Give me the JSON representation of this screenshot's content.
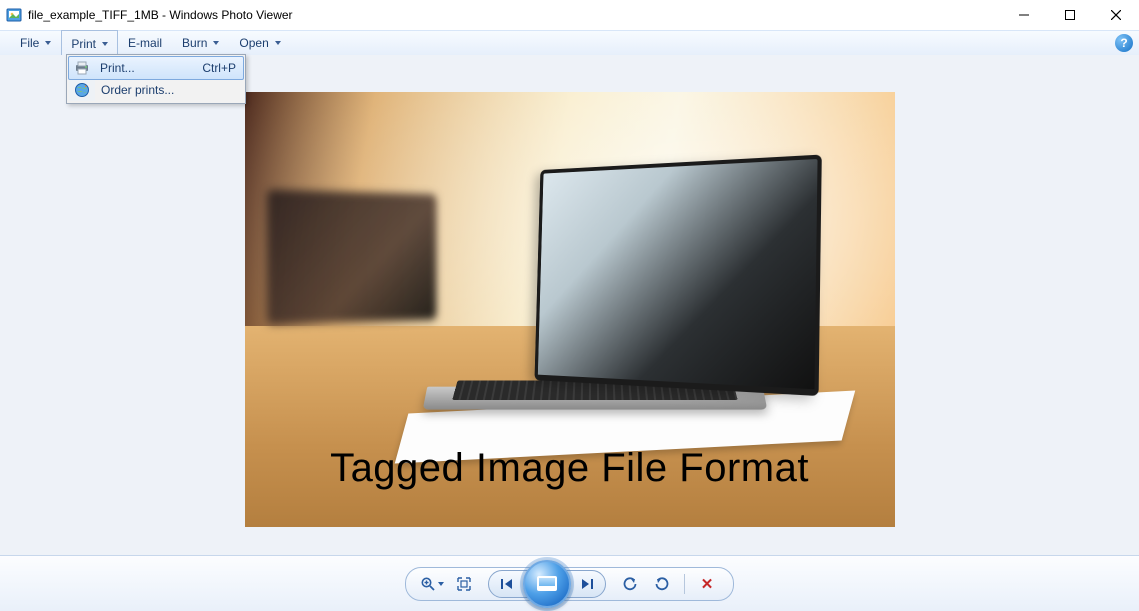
{
  "window": {
    "title": "file_example_TIFF_1MB - Windows Photo Viewer"
  },
  "menubar": {
    "file": {
      "label": "File",
      "has_dropdown": true
    },
    "print": {
      "label": "Print",
      "has_dropdown": true,
      "open": true
    },
    "email": {
      "label": "E-mail",
      "has_dropdown": false
    },
    "burn": {
      "label": "Burn",
      "has_dropdown": true
    },
    "open": {
      "label": "Open",
      "has_dropdown": true
    }
  },
  "print_menu": {
    "items": [
      {
        "icon": "printer-icon",
        "label": "Print...",
        "shortcut": "Ctrl+P",
        "highlight": true
      },
      {
        "icon": "globe-icon",
        "label": "Order prints...",
        "shortcut": "",
        "highlight": false
      }
    ]
  },
  "image": {
    "watermark_text": "Tagged Image File Format"
  },
  "toolbar": {
    "zoom": "Change the display size",
    "actual_size": "Actual size",
    "previous": "Previous",
    "slideshow": "Play slide show",
    "next": "Next",
    "rotate_ccw": "Rotate counterclockwise",
    "rotate_cw": "Rotate clockwise",
    "delete": "Delete"
  }
}
